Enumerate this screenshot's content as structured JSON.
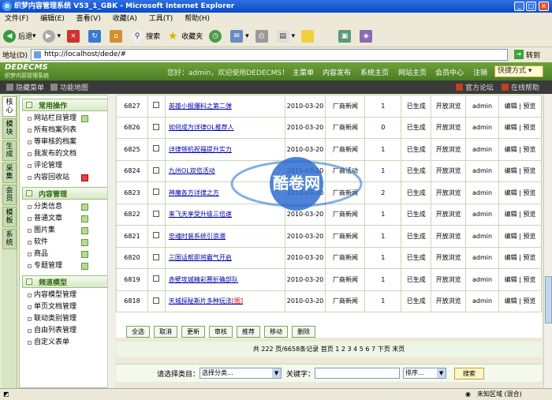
{
  "window": {
    "title": "织梦内容管理系统 V53_1_GBK - Microsoft Internet Explorer"
  },
  "menu": [
    "文件(F)",
    "编辑(E)",
    "查看(V)",
    "收藏(A)",
    "工具(T)",
    "帮助(H)"
  ],
  "toolbar": {
    "back": "后退",
    "search": "搜索",
    "favorites": "收藏夹"
  },
  "address": {
    "label": "地址(D)",
    "url": "http://localhost/dede/#",
    "go": "转到"
  },
  "cms": {
    "logo": "DEDECMS",
    "logo_sub": "织梦内容管理系统",
    "welcome": "您好：admin，欢迎使用DEDECMS！",
    "nav": [
      "主菜单",
      "内容发布",
      "系统主页",
      "网站主页",
      "会员中心",
      "注销"
    ],
    "quick": "快捷方式"
  },
  "subbar": {
    "hide_menu": "隐藏菜单",
    "function_map": "功能地图",
    "forum": "官方论坛",
    "help": "在线帮助"
  },
  "vtabs": [
    "核心",
    "模块",
    "生成",
    "采集",
    "会员",
    "模板",
    "系统"
  ],
  "sidebar": {
    "groups": [
      {
        "title": "常用操作",
        "items": [
          "网站栏目管理",
          "所有档案列表",
          "等审核的档案",
          "我发布的文档",
          "评论管理",
          "内容回收站"
        ]
      },
      {
        "title": "内容管理",
        "items": [
          "分类信息",
          "普通文章",
          "图片集",
          "软件",
          "商品",
          "专题管理"
        ]
      },
      {
        "title": "频道模型",
        "items": [
          "内容模型管理",
          "单页文档管理",
          "联动类别管理",
          "自由列表管理",
          "自定义表单"
        ]
      }
    ]
  },
  "table": {
    "rows": [
      {
        "id": "6827",
        "title": "英雄小报爆料之第二弹",
        "date": "2010-03-20",
        "cat": "厂商新闻",
        "count": "1",
        "status": "已生成",
        "browse": "开放浏览",
        "author": "admin"
      },
      {
        "id": "6826",
        "title": "如何成为详律OL推荐人",
        "date": "2010-03-20",
        "cat": "厂商新闻",
        "count": "0",
        "status": "已生成",
        "browse": "开放浏览",
        "author": "admin"
      },
      {
        "id": "6825",
        "title": "详律顿机祝福提升实力",
        "date": "2010-03-20",
        "cat": "厂商新闻",
        "count": "1",
        "status": "已生成",
        "browse": "开放浏览",
        "author": "admin"
      },
      {
        "id": "6824",
        "title": "九州OL双倍活动",
        "date": "2010-03-20",
        "cat": "厂商活动",
        "count": "1",
        "status": "已生成",
        "browse": "开放浏览",
        "author": "admin"
      },
      {
        "id": "6823",
        "title": "神魔各方详律之方",
        "date": "2010-03-20",
        "cat": "厂商新闻",
        "count": "2",
        "status": "已生成",
        "browse": "开放浏览",
        "author": "admin"
      },
      {
        "id": "6822",
        "title": "来飞天享受升级三倍速",
        "date": "2010-03-20",
        "cat": "厂商新闻",
        "count": "1",
        "status": "已生成",
        "browse": "开放浏览",
        "author": "admin"
      },
      {
        "id": "6821",
        "title": "忠魂时装系统引浪潮",
        "date": "2010-03-20",
        "cat": "厂商新闻",
        "count": "1",
        "status": "已生成",
        "browse": "开放浏览",
        "author": "admin"
      },
      {
        "id": "6820",
        "title": "三国话帮即将霸气开启",
        "date": "2010-03-20",
        "cat": "厂商新闻",
        "count": "1",
        "status": "已生成",
        "browse": "开放浏览",
        "author": "admin"
      },
      {
        "id": "6819",
        "title": "赤壁攻城精彩赛折确部队",
        "date": "2010-03-20",
        "cat": "厂商新闻",
        "count": "1",
        "status": "已生成",
        "browse": "开放浏览",
        "author": "admin"
      },
      {
        "id": "6818",
        "title": "天城探秘斯片多种玩法",
        "date": "2010-03-20",
        "cat": "厂商新闻",
        "count": "1",
        "status": "已生成",
        "browse": "开放浏览",
        "author": "admin"
      }
    ],
    "edit": "编辑",
    "preview": "预览",
    "img_tag": "[图]"
  },
  "actions": [
    "全选",
    "取消",
    "更新",
    "审核",
    "推荐",
    "移动",
    "删除"
  ],
  "pager": "共 222 页/6658条记录 首页 1 2 3 4 5 6 7 下页 末页",
  "search": {
    "cat_label": "请选择类目：",
    "cat_value": "选择分类...",
    "kw_label": "关键字：",
    "order": "排序...",
    "button": "搜索"
  },
  "status": {
    "zone": "未知区域 (混合)"
  },
  "watermark": {
    "text": "酷卷网"
  }
}
